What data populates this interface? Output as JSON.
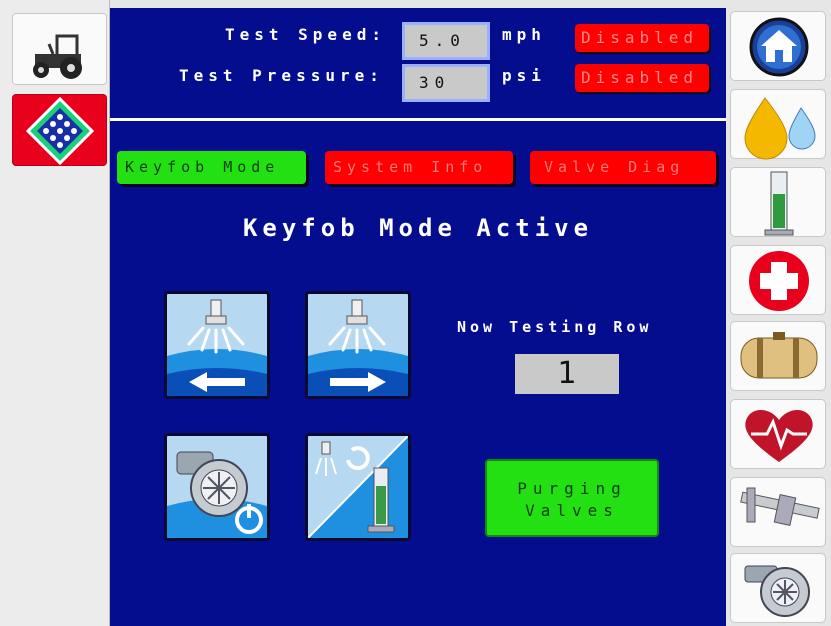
{
  "header": {
    "test_speed_label": "Test Speed:",
    "test_speed_value": "5.0",
    "test_speed_unit": "mph",
    "test_speed_status": "Disabled",
    "test_pressure_label": "Test Pressure:",
    "test_pressure_value": "30",
    "test_pressure_unit": "psi",
    "test_pressure_status": "Disabled"
  },
  "tabs": [
    {
      "label": "Keyfob Mode",
      "state": "active"
    },
    {
      "label": "System Info",
      "state": "inactive"
    },
    {
      "label": "Valve Diag",
      "state": "inactive"
    }
  ],
  "main": {
    "title": "Keyfob Mode Active",
    "now_testing_label": "Now Testing Row",
    "now_testing_value": "1",
    "purge_line1": "Purging",
    "purge_line2": "Valves"
  },
  "left_nav": [
    {
      "icon": "tractor-icon"
    },
    {
      "icon": "diamond-grid-icon",
      "state": "selected"
    }
  ],
  "right_nav": [
    {
      "icon": "home-icon"
    },
    {
      "icon": "product-drops-icon"
    },
    {
      "icon": "calibration-cylinder-icon"
    },
    {
      "icon": "first-aid-cross-icon"
    },
    {
      "icon": "tank-icon"
    },
    {
      "icon": "heartbeat-icon"
    },
    {
      "icon": "caliper-icon"
    },
    {
      "icon": "pump-icon"
    }
  ],
  "colors": {
    "background": "#050d8f",
    "active_green": "#22e012",
    "alert_red": "#ff0000",
    "field_gray": "#c9c9c9"
  }
}
